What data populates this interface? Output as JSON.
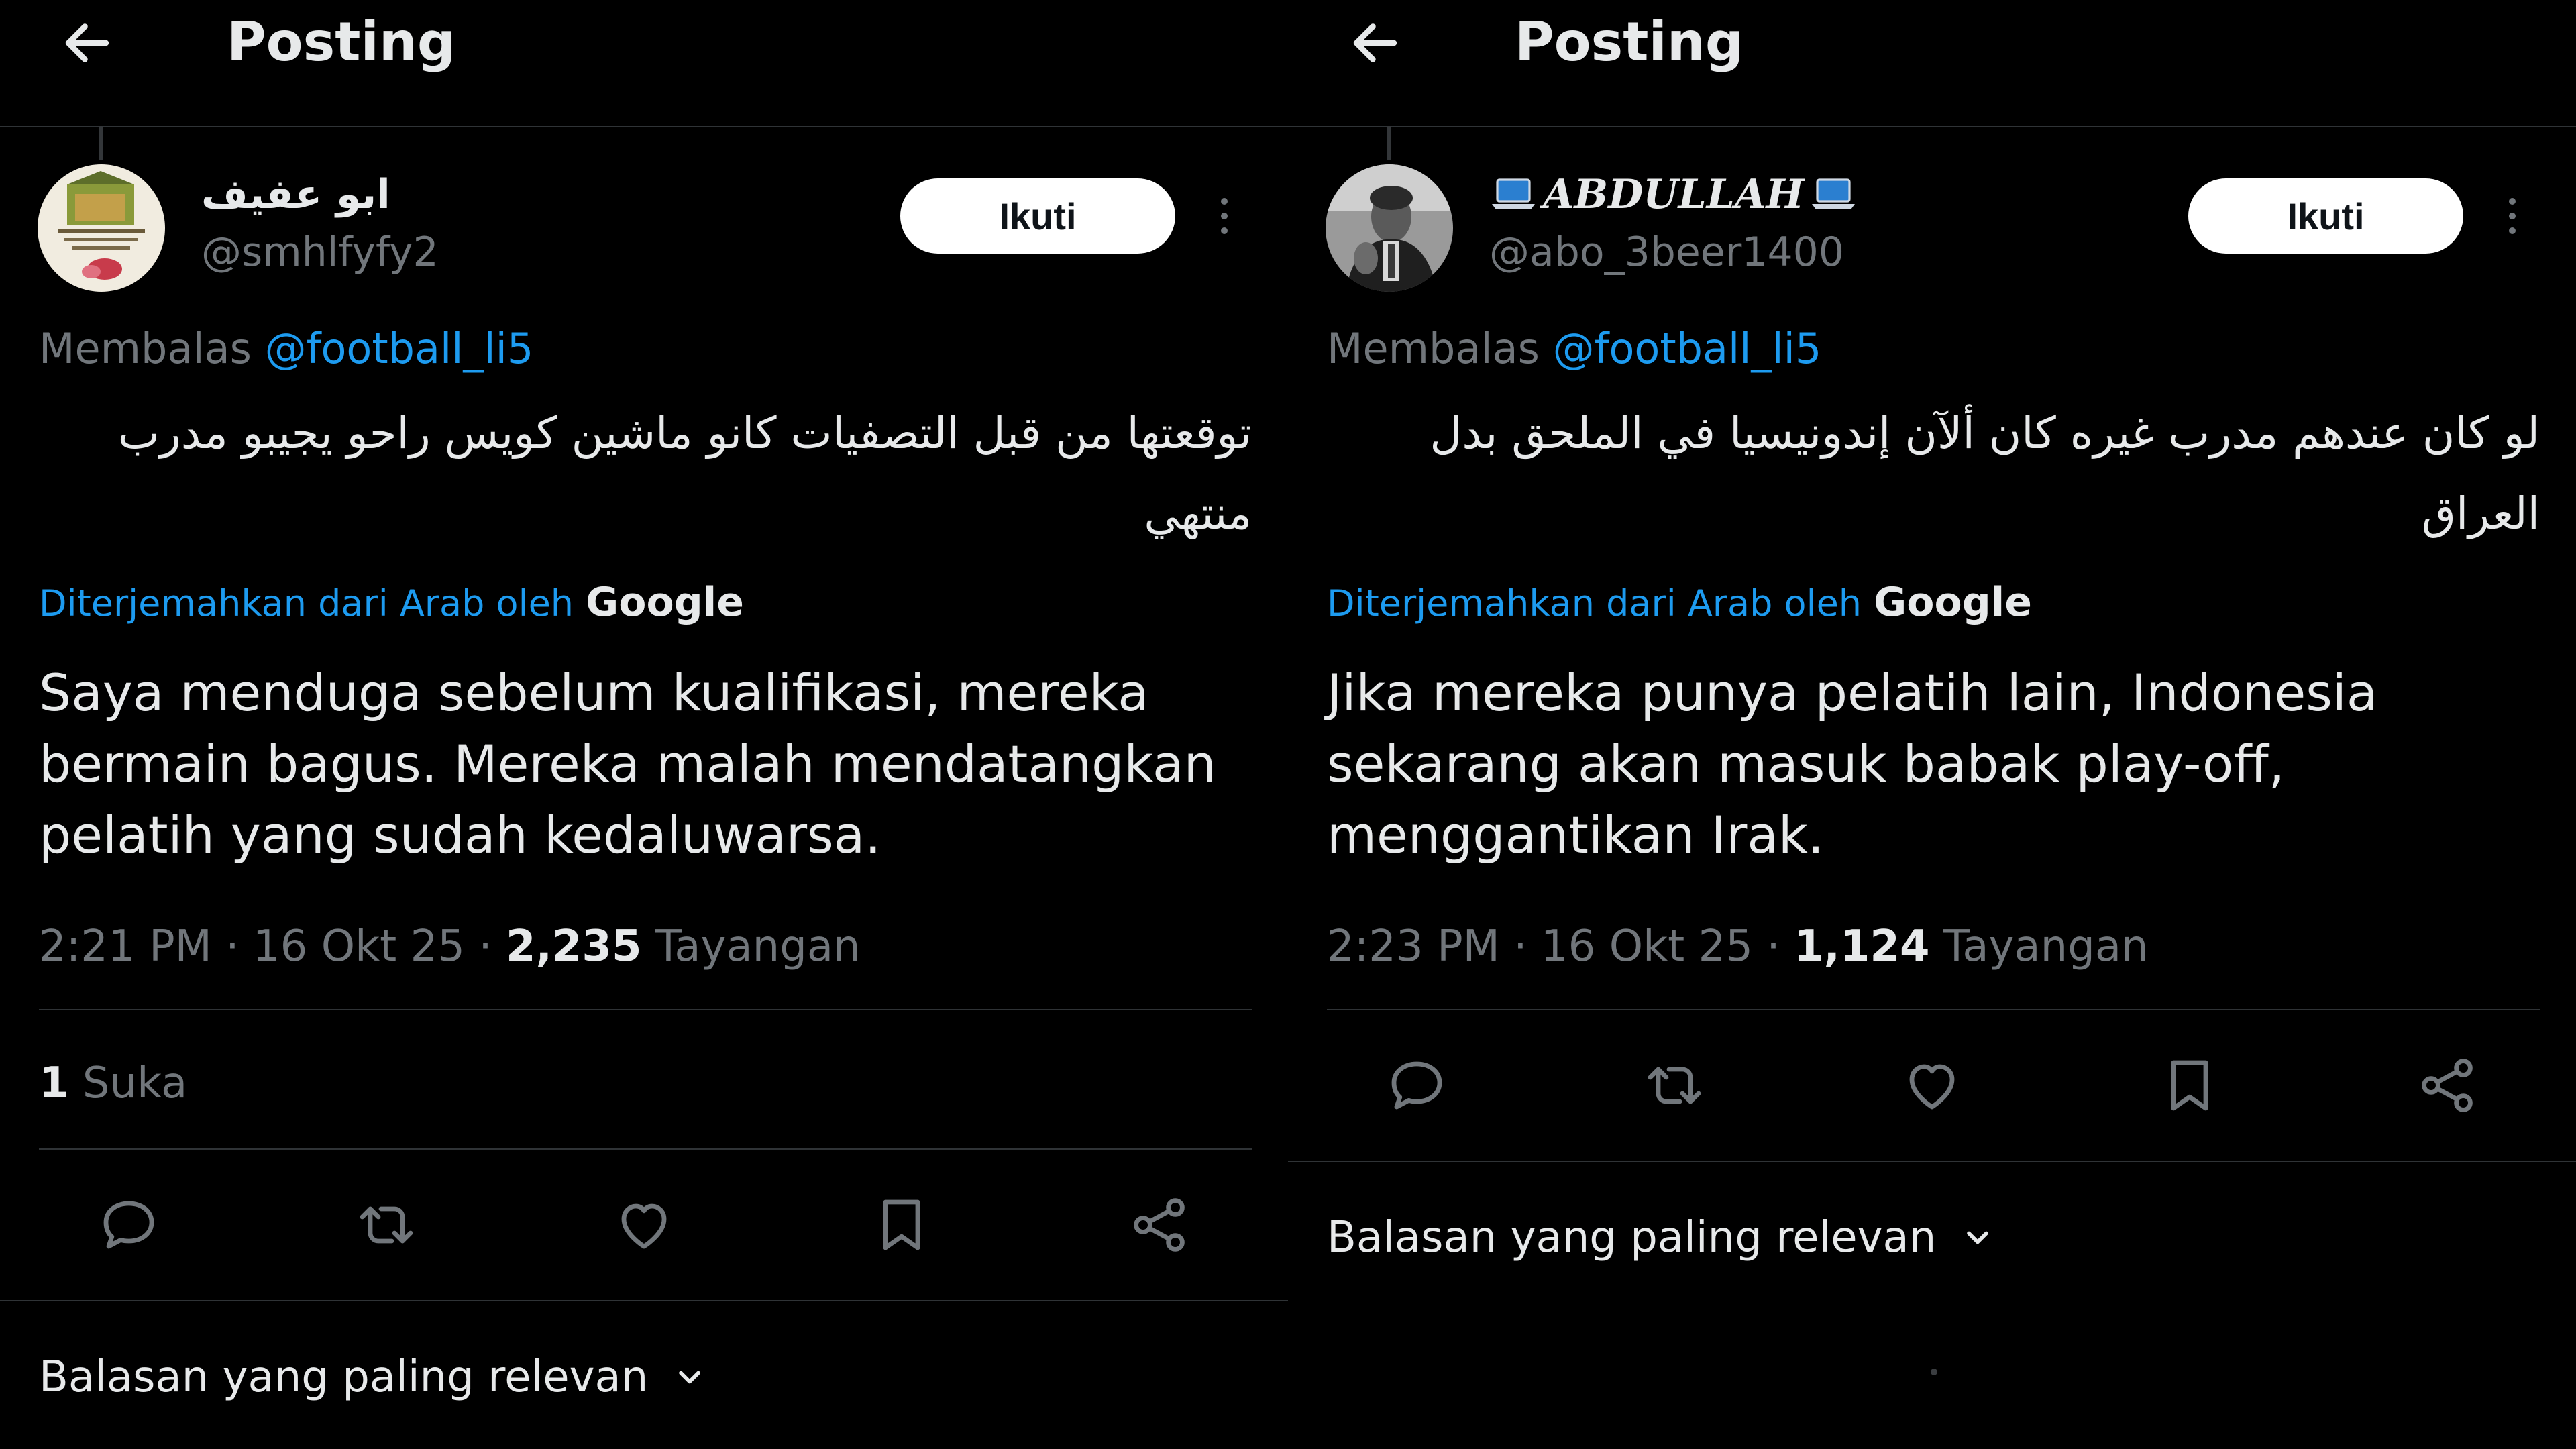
{
  "theme": {
    "background": "#000000",
    "text_primary": "#e7e9ea",
    "text_secondary": "#71767b",
    "link": "#1d9bf0",
    "divider": "#2f3336",
    "follow_button_bg": "#ffffff"
  },
  "icons": {
    "back": "arrow-left-icon",
    "more": "vertical-ellipsis-icon",
    "reply": "speech-bubble-icon",
    "repost": "repost-arrows-icon",
    "like": "heart-icon",
    "bookmark": "bookmark-icon",
    "share": "share-nodes-icon",
    "sort": "chevron-down-icon"
  },
  "left": {
    "header": {
      "title": "Posting"
    },
    "author": {
      "display_name": "ابو عفيف",
      "handle": "@smhlfyfy2"
    },
    "follow_label": "Ikuti",
    "reply_to": {
      "prefix": "Membalas",
      "mention": "@football_li5"
    },
    "original_text": "توقعتها من قبل التصفيات كانو ماشين كويس راحو يجيبو مدرب منتهي",
    "translated_by": {
      "label": "Diterjemahkan dari Arab oleh",
      "brand": "Google"
    },
    "translation": "Saya menduga sebelum kualifikasi, mereka bermain bagus. Mereka malah mendatangkan pelatih yang sudah kedaluwarsa.",
    "meta": {
      "time": "2:21 PM",
      "date": "16 Okt 25",
      "views": "2,235",
      "views_label": "Tayangan",
      "sep": "·"
    },
    "likes": {
      "count": "1",
      "label": "Suka"
    },
    "sort_label": "Balasan yang paling relevan"
  },
  "right": {
    "header": {
      "title": "Posting"
    },
    "author": {
      "display_name": "ABDULLAH",
      "handle": "@abo_3beer1400"
    },
    "follow_label": "Ikuti",
    "reply_to": {
      "prefix": "Membalas",
      "mention": "@football_li5"
    },
    "original_text": "لو كان عندهم مدرب غيره كان ألآن إندونيسيا في الملحق بدل العراق",
    "translated_by": {
      "label": "Diterjemahkan dari Arab oleh",
      "brand": "Google"
    },
    "translation": "Jika mereka punya pelatih lain, Indonesia sekarang akan masuk babak play-off, menggantikan Irak.",
    "meta": {
      "time": "2:23 PM",
      "date": "16 Okt 25",
      "views": "1,124",
      "views_label": "Tayangan",
      "sep": "·"
    },
    "sort_label": "Balasan yang paling relevan"
  }
}
